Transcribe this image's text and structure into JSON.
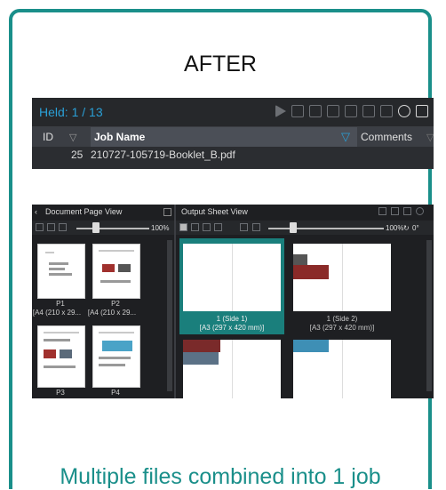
{
  "heading": "AFTER",
  "caption": "Multiple files combined into 1 job",
  "queue": {
    "held_label": "Held: 1 / 13",
    "columns": {
      "id": "ID",
      "job_name": "Job Name",
      "comments": "Comments"
    },
    "rows": [
      {
        "id": "25",
        "job_name": "210727-105719-Booklet_B.pdf"
      }
    ]
  },
  "document_view": {
    "title": "Document Page View",
    "zoom": "100%",
    "pages": [
      {
        "label": "P1",
        "size": "[A4 (210 x 29..."
      },
      {
        "label": "P2",
        "size": "[A4 (210 x 29..."
      },
      {
        "label": "P3",
        "size": ""
      },
      {
        "label": "P4",
        "size": ""
      }
    ]
  },
  "output_view": {
    "title": "Output Sheet View",
    "zoom": "100%",
    "rotation": "0°",
    "sheets": [
      {
        "label": "1 (Side 1)",
        "size": "[A3 (297 x 420 mm)]",
        "selected": true
      },
      {
        "label": "1 (Side 2)",
        "size": "[A3 (297 x 420 mm)]",
        "selected": false
      }
    ]
  },
  "colors": {
    "accent": "#1a8f8a",
    "held": "#2a9fd6",
    "panel_bg": "#2b2d31"
  }
}
